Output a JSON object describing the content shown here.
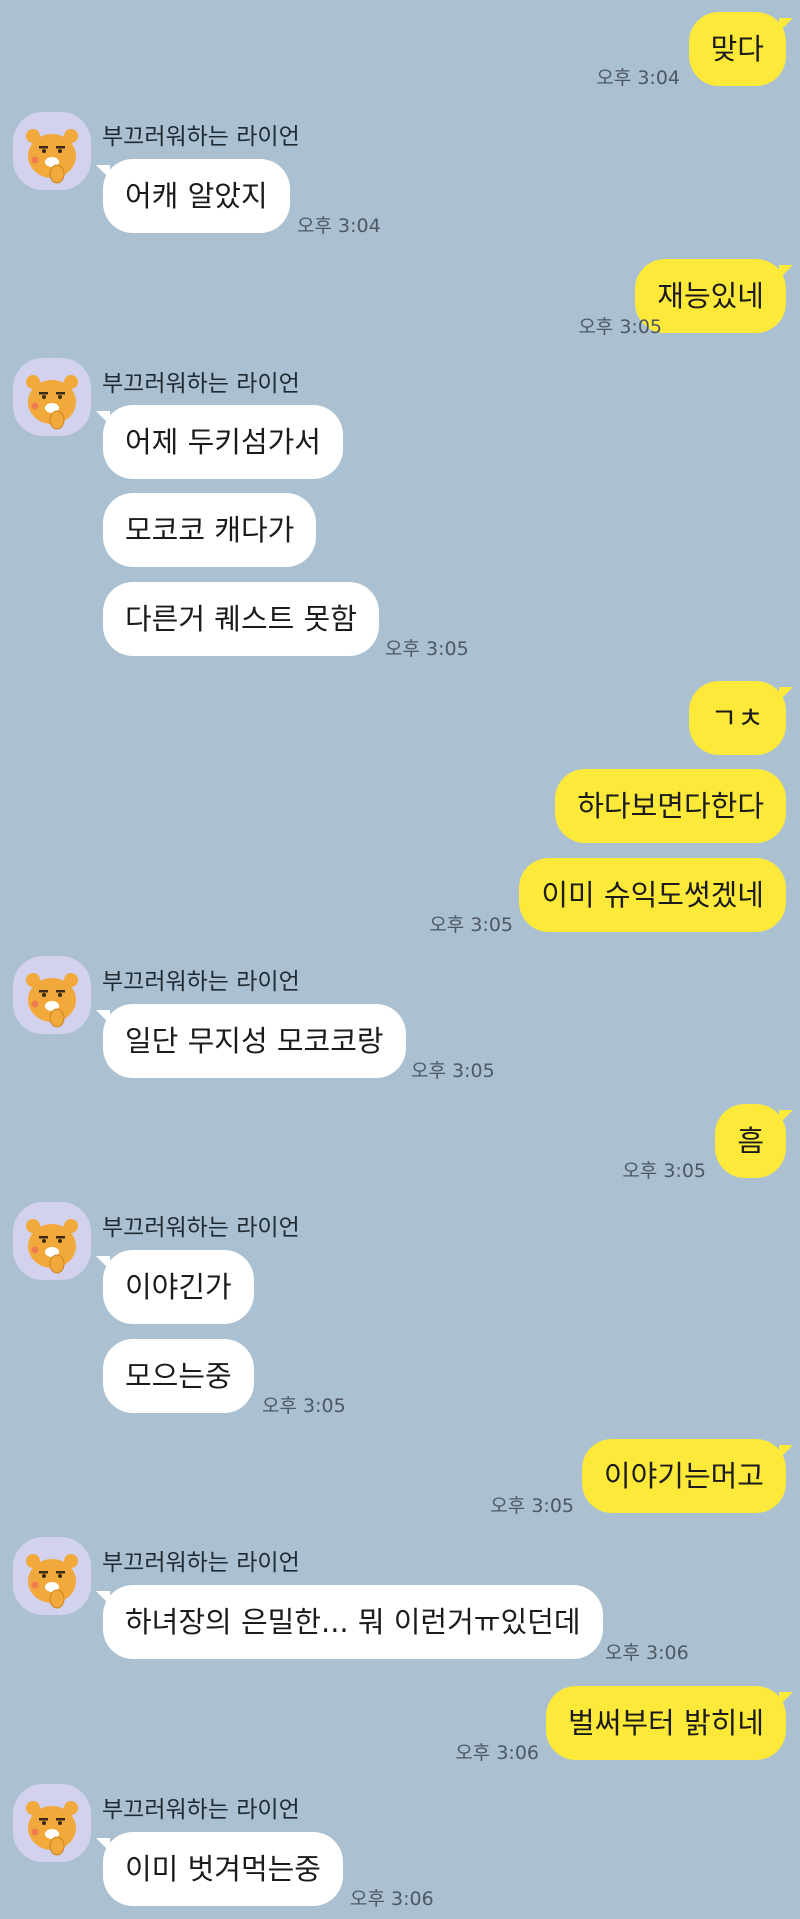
{
  "colors": {
    "background": "#abc1d1",
    "my_bubble": "#fde93a",
    "other_bubble": "#ffffff",
    "avatar_bg": "#d3d2ee"
  },
  "sender_name": "부끄러워하는 라이언",
  "avatar_icon": "ryan-character-icon",
  "messages": [
    {
      "side": "me",
      "text": "맞다",
      "time": "오후 3:04"
    },
    {
      "side": "other",
      "text": "어캐 알았지",
      "time": "오후 3:04"
    },
    {
      "side": "me",
      "text": "재능있네",
      "time": "오후 3:05"
    },
    {
      "side": "other",
      "text": "어제 두키섬가서"
    },
    {
      "side": "other",
      "text": "모코코 캐다가"
    },
    {
      "side": "other",
      "text": "다른거 퀘스트 못함",
      "time": "오후 3:05"
    },
    {
      "side": "me",
      "text": "ㄱㅊ"
    },
    {
      "side": "me",
      "text": "하다보면다한다"
    },
    {
      "side": "me",
      "text": "이미 슈익도썻겠네",
      "time": "오후 3:05"
    },
    {
      "side": "other",
      "text": "일단 무지성 모코코랑",
      "time": "오후 3:05"
    },
    {
      "side": "me",
      "text": "흠",
      "time": "오후 3:05"
    },
    {
      "side": "other",
      "text": "이야긴가"
    },
    {
      "side": "other",
      "text": "모으는중",
      "time": "오후 3:05"
    },
    {
      "side": "me",
      "text": "이야기는머고",
      "time": "오후 3:05"
    },
    {
      "side": "other",
      "text": "하녀장의 은밀한... 뭐 이런거ㅠ있던데",
      "time": "오후 3:06"
    },
    {
      "side": "me",
      "text": "벌써부터 밝히네",
      "time": "오후 3:06"
    },
    {
      "side": "other",
      "text": "이미 벗겨먹는중",
      "time": "오후 3:06"
    }
  ]
}
